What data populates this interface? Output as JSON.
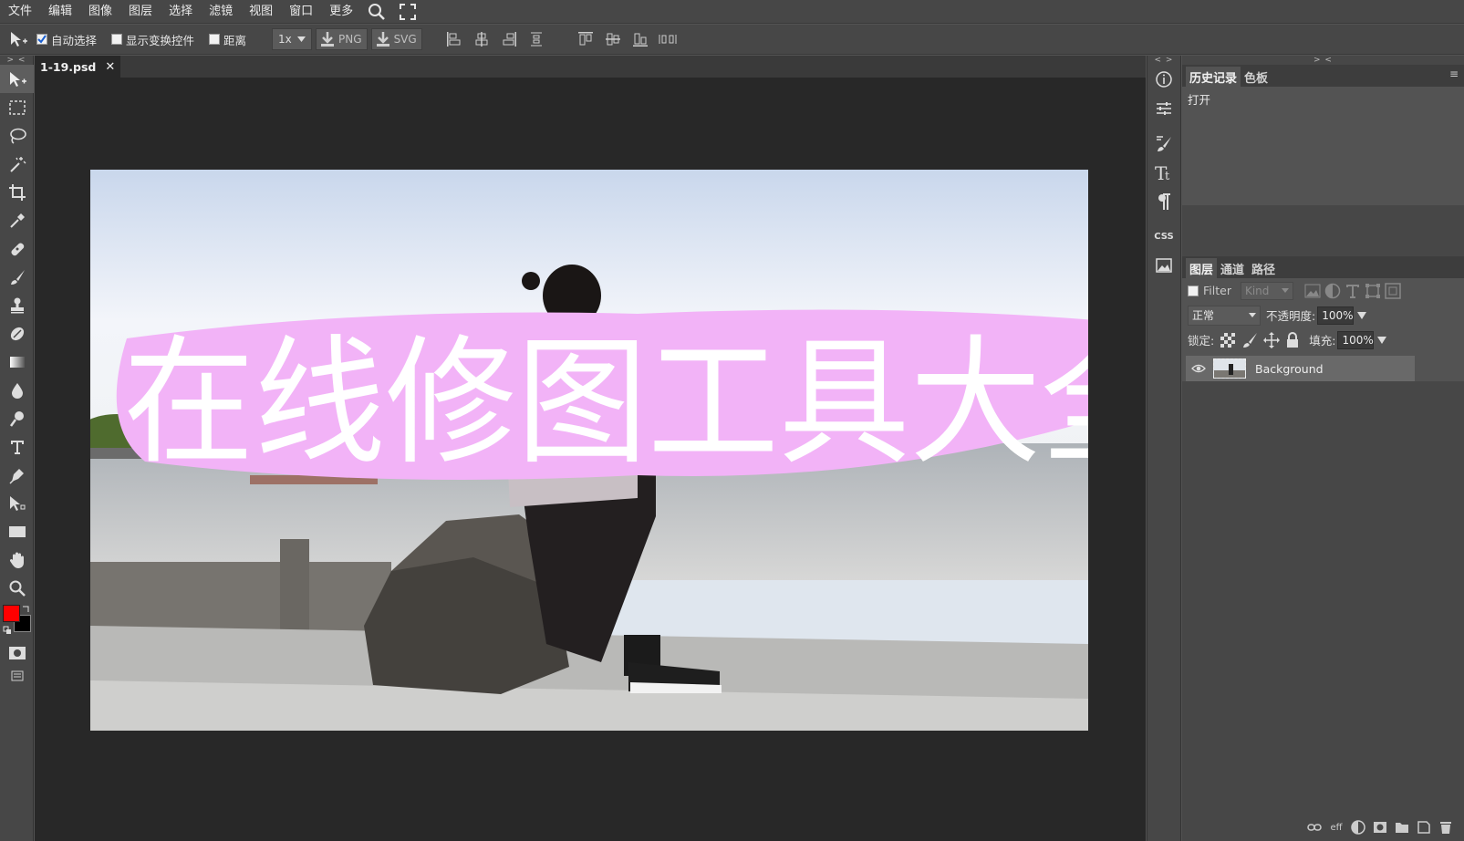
{
  "menu": {
    "items": [
      "文件",
      "编辑",
      "图像",
      "图层",
      "选择",
      "滤镜",
      "视图",
      "窗口",
      "更多"
    ]
  },
  "options": {
    "auto_select": "自动选择",
    "show_transform": "显示变换控件",
    "distance": "距离",
    "scale": "1x",
    "png": "PNG",
    "svg": "SVG"
  },
  "panel_collapse": {
    "left": "> <",
    "mid": "< >",
    "right": "> <"
  },
  "document": {
    "tab_name": "1-19.psd",
    "close": "✕",
    "overlay_text": "在线修图工具大全"
  },
  "history_panel": {
    "tabs": [
      "历史记录",
      "色板"
    ],
    "entries": [
      "打开"
    ],
    "menu": "≡"
  },
  "layers_panel": {
    "tabs": [
      "图层",
      "通道",
      "路径"
    ],
    "filter_label": "Filter",
    "kind_placeholder": "Kind",
    "blend_mode": "正常",
    "opacity_label": "不透明度:",
    "opacity_value": "100%",
    "lock_label": "锁定:",
    "fill_label": "填充:",
    "fill_value": "100%",
    "layers": [
      {
        "name": "Background",
        "visible": true
      }
    ]
  },
  "layers_footer": {
    "effects": "eff"
  },
  "mid_column": {
    "css_label": "CSS"
  },
  "colors": {
    "foreground": "#ff0000",
    "background": "#000000",
    "overlay_brush": "#f2b3f7"
  }
}
